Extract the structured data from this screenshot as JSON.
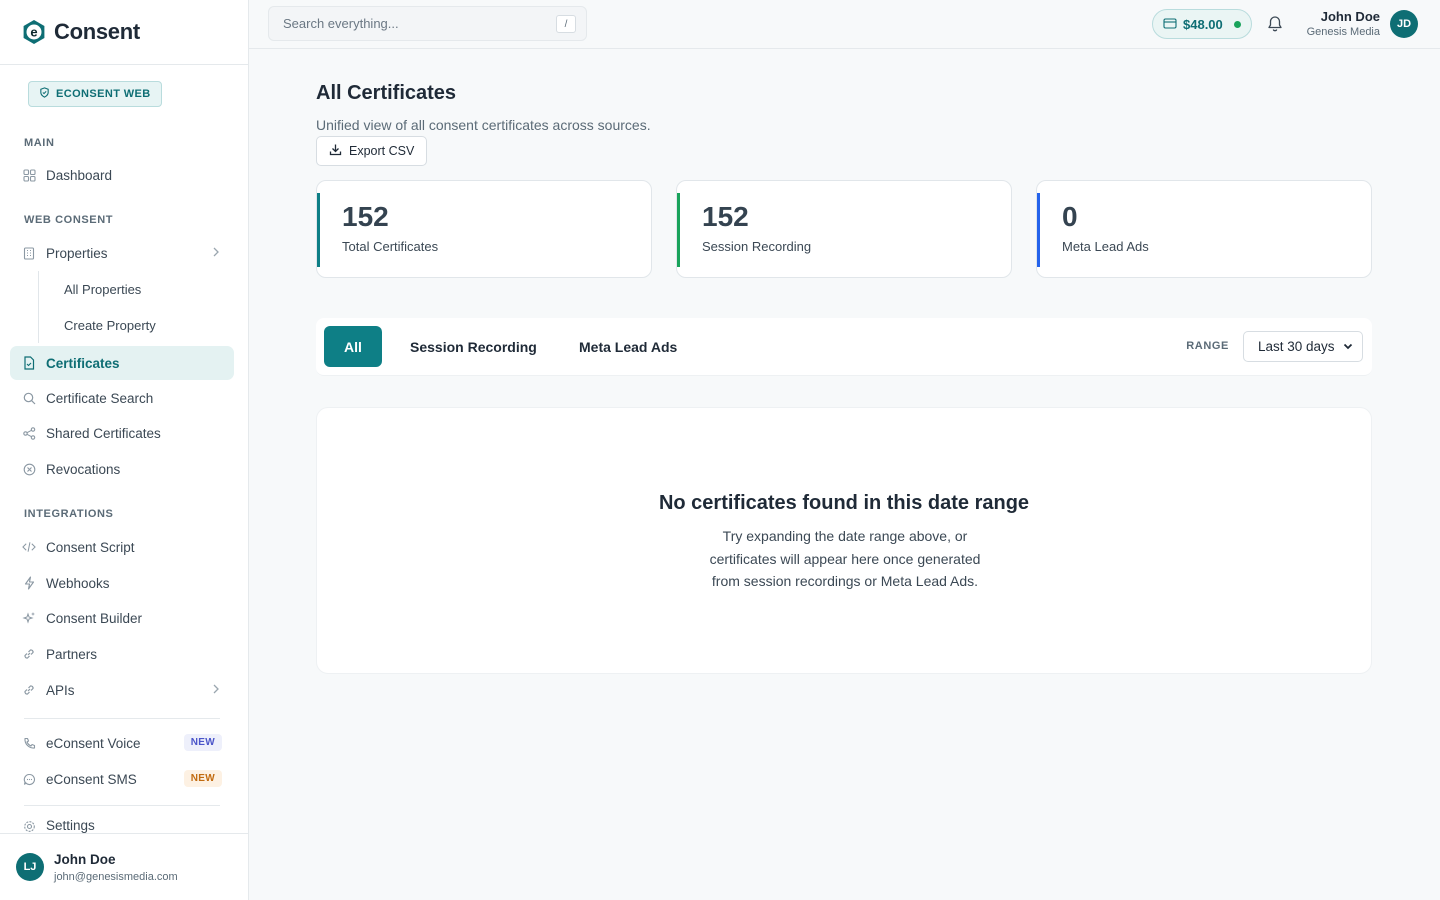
{
  "brand": {
    "name": "Consent",
    "badge": "ECONSENT WEB"
  },
  "sidebar": {
    "sections": {
      "main": "MAIN",
      "web_consent": "WEB CONSENT",
      "integrations": "INTEGRATIONS"
    },
    "dashboard": "Dashboard",
    "properties": "Properties",
    "all_properties": "All Properties",
    "create_property": "Create Property",
    "certificates": "Certificates",
    "certificate_search": "Certificate Search",
    "shared_certificates": "Shared Certificates",
    "revocations": "Revocations",
    "consent_script": "Consent Script",
    "webhooks": "Webhooks",
    "consent_builder": "Consent Builder",
    "partners": "Partners",
    "apis": "APIs",
    "voice": "eConsent Voice",
    "sms": "eConsent SMS",
    "new_tag": "NEW",
    "settings": "Settings"
  },
  "footer_user": {
    "initials": "LJ",
    "name": "John Doe",
    "email": "john@genesismedia.com"
  },
  "topbar": {
    "search_placeholder": "Search everything...",
    "search_shortcut": "/",
    "balance": "$48.00",
    "user_name": "John Doe",
    "user_org": "Genesis Media",
    "user_initials": "JD"
  },
  "page": {
    "title": "All Certificates",
    "subtitle": "Unified view of all consent certificates across sources.",
    "export_label": "Export CSV"
  },
  "stats": [
    {
      "value": "152",
      "label": "Total Certificates",
      "color": "#0e7f86"
    },
    {
      "value": "152",
      "label": "Session Recording",
      "color": "#19a35b"
    },
    {
      "value": "0",
      "label": "Meta Lead Ads",
      "color": "#2563eb"
    }
  ],
  "tabs": {
    "all": "All",
    "session": "Session Recording",
    "meta": "Meta Lead Ads"
  },
  "range": {
    "label": "RANGE",
    "selected": "Last 30 days"
  },
  "empty": {
    "title": "No certificates found in this date range",
    "line1": "Try expanding the date range above, or",
    "line2": "certificates will appear here once generated",
    "line3": "from session recordings or Meta Lead Ads."
  }
}
